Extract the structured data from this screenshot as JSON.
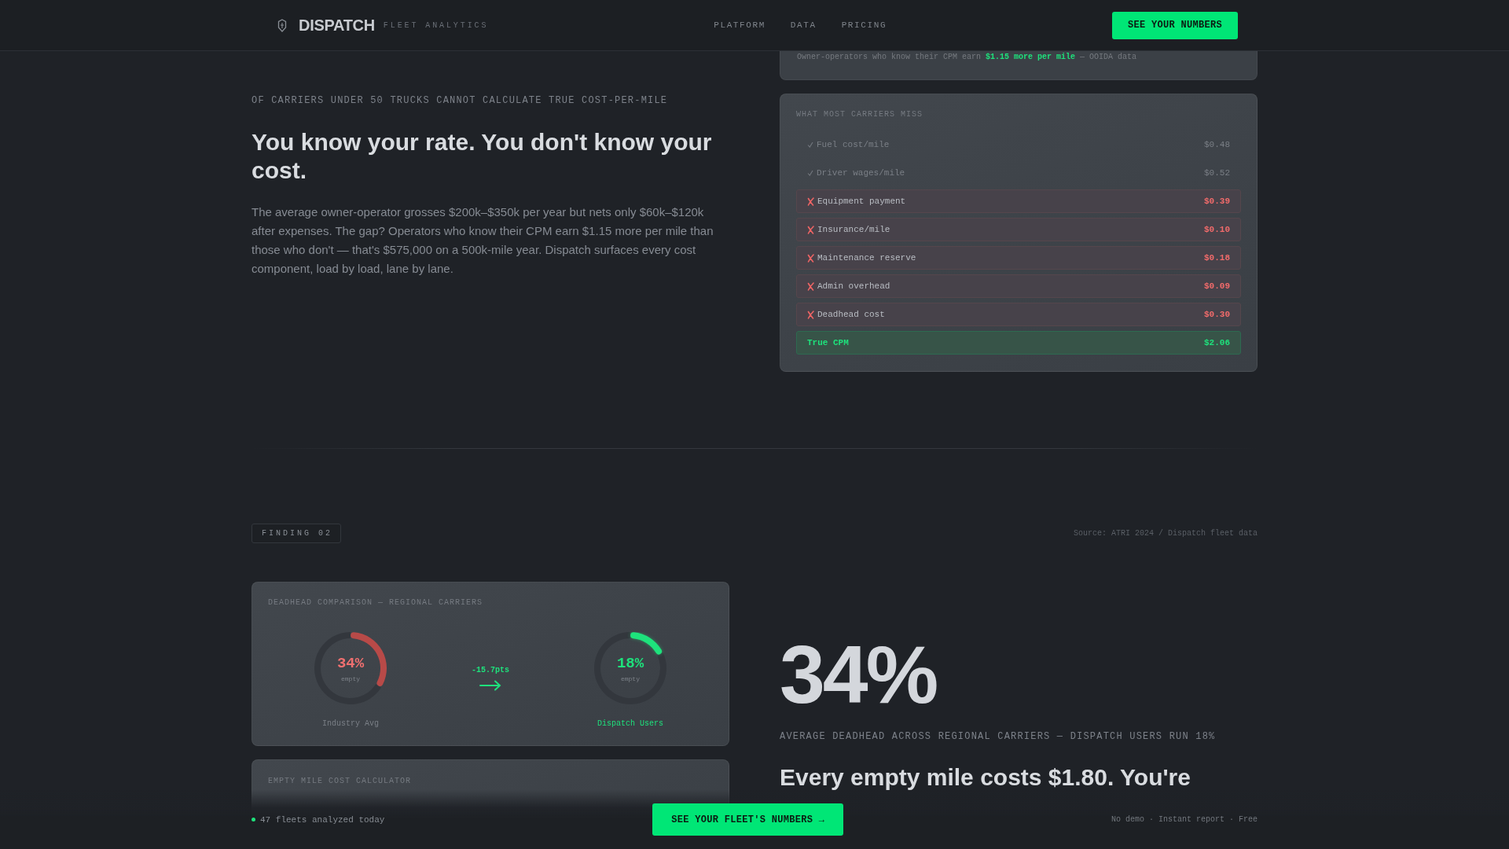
{
  "nav": {
    "brand": "DISPATCH",
    "tagline": "FLEET ANALYTICS",
    "links": [
      "PLATFORM",
      "DATA",
      "PRICING"
    ],
    "cta": "SEE YOUR NUMBERS"
  },
  "finding_1": {
    "stat_caption": "OF CARRIERS UNDER 50 TRUCKS CANNOT CALCULATE TRUE COST-PER-MILE",
    "headline": "You know your rate. You don't know your cost.",
    "body": "The average owner-operator grosses $200k–$350k per year but nets only $60k–$120k after expenses. The gap? Operators who know their CPM earn $1.15 more per mile than those who don't — that's $575,000 on a 500k-mile year. Dispatch surfaces every cost component, load by load, lane by lane.",
    "note_card": {
      "text": "Owner-operators who know their CPM earn **$1.15 more per mile** — OOIDA data"
    },
    "breakdown": {
      "title": "WHAT MOST CARRIERS MISS",
      "rows": [
        {
          "kind": "known",
          "label": "Fuel cost/mile",
          "value": "$0.48"
        },
        {
          "kind": "known",
          "label": "Driver wages/mile",
          "value": "$0.52"
        },
        {
          "kind": "missed",
          "label": "Equipment payment",
          "value": "$0.39"
        },
        {
          "kind": "missed",
          "label": "Insurance/mile",
          "value": "$0.10"
        },
        {
          "kind": "missed",
          "label": "Maintenance reserve",
          "value": "$0.18"
        },
        {
          "kind": "missed",
          "label": "Admin overhead",
          "value": "$0.09"
        },
        {
          "kind": "missed",
          "label": "Deadhead cost",
          "value": "$0.30"
        },
        {
          "kind": "total",
          "label": "True CPM",
          "value": "$2.06"
        }
      ]
    }
  },
  "finding_2": {
    "badge": "FINDING 02",
    "source": "Source: ATRI 2024 / Dispatch fleet data",
    "comparison": {
      "title": "DEADHEAD COMPARISON — REGIONAL CARRIERS",
      "gauges": [
        {
          "kind": "industry",
          "value": "34%",
          "unit": "empty",
          "label": "Industry Avg",
          "chart_data": {
            "type": "donut",
            "values": [
              34,
              66
            ],
            "colors": [
              "#b84a48",
              "#33373d"
            ]
          }
        },
        {
          "kind": "dispatch",
          "value": "18%",
          "unit": "empty",
          "label": "Dispatch Users",
          "chart_data": {
            "type": "donut",
            "values": [
              18,
              82
            ],
            "colors": [
              "#1ee27c",
              "#33373d"
            ]
          }
        }
      ],
      "delta": "-15.7pts"
    },
    "calculator": {
      "title": "EMPTY MILE COST CALCULATOR"
    },
    "stat": "34%",
    "stat_caption": "AVERAGE DEADHEAD ACROSS REGIONAL CARRIERS — DISPATCH USERS RUN 18%",
    "headline": "Every empty mile costs $1.80. You're"
  },
  "bottom_bar": {
    "status": "47 fleets analyzed today",
    "cta": "SEE YOUR FLEET'S NUMBERS →",
    "note": "No demo · Instant report · Free"
  }
}
